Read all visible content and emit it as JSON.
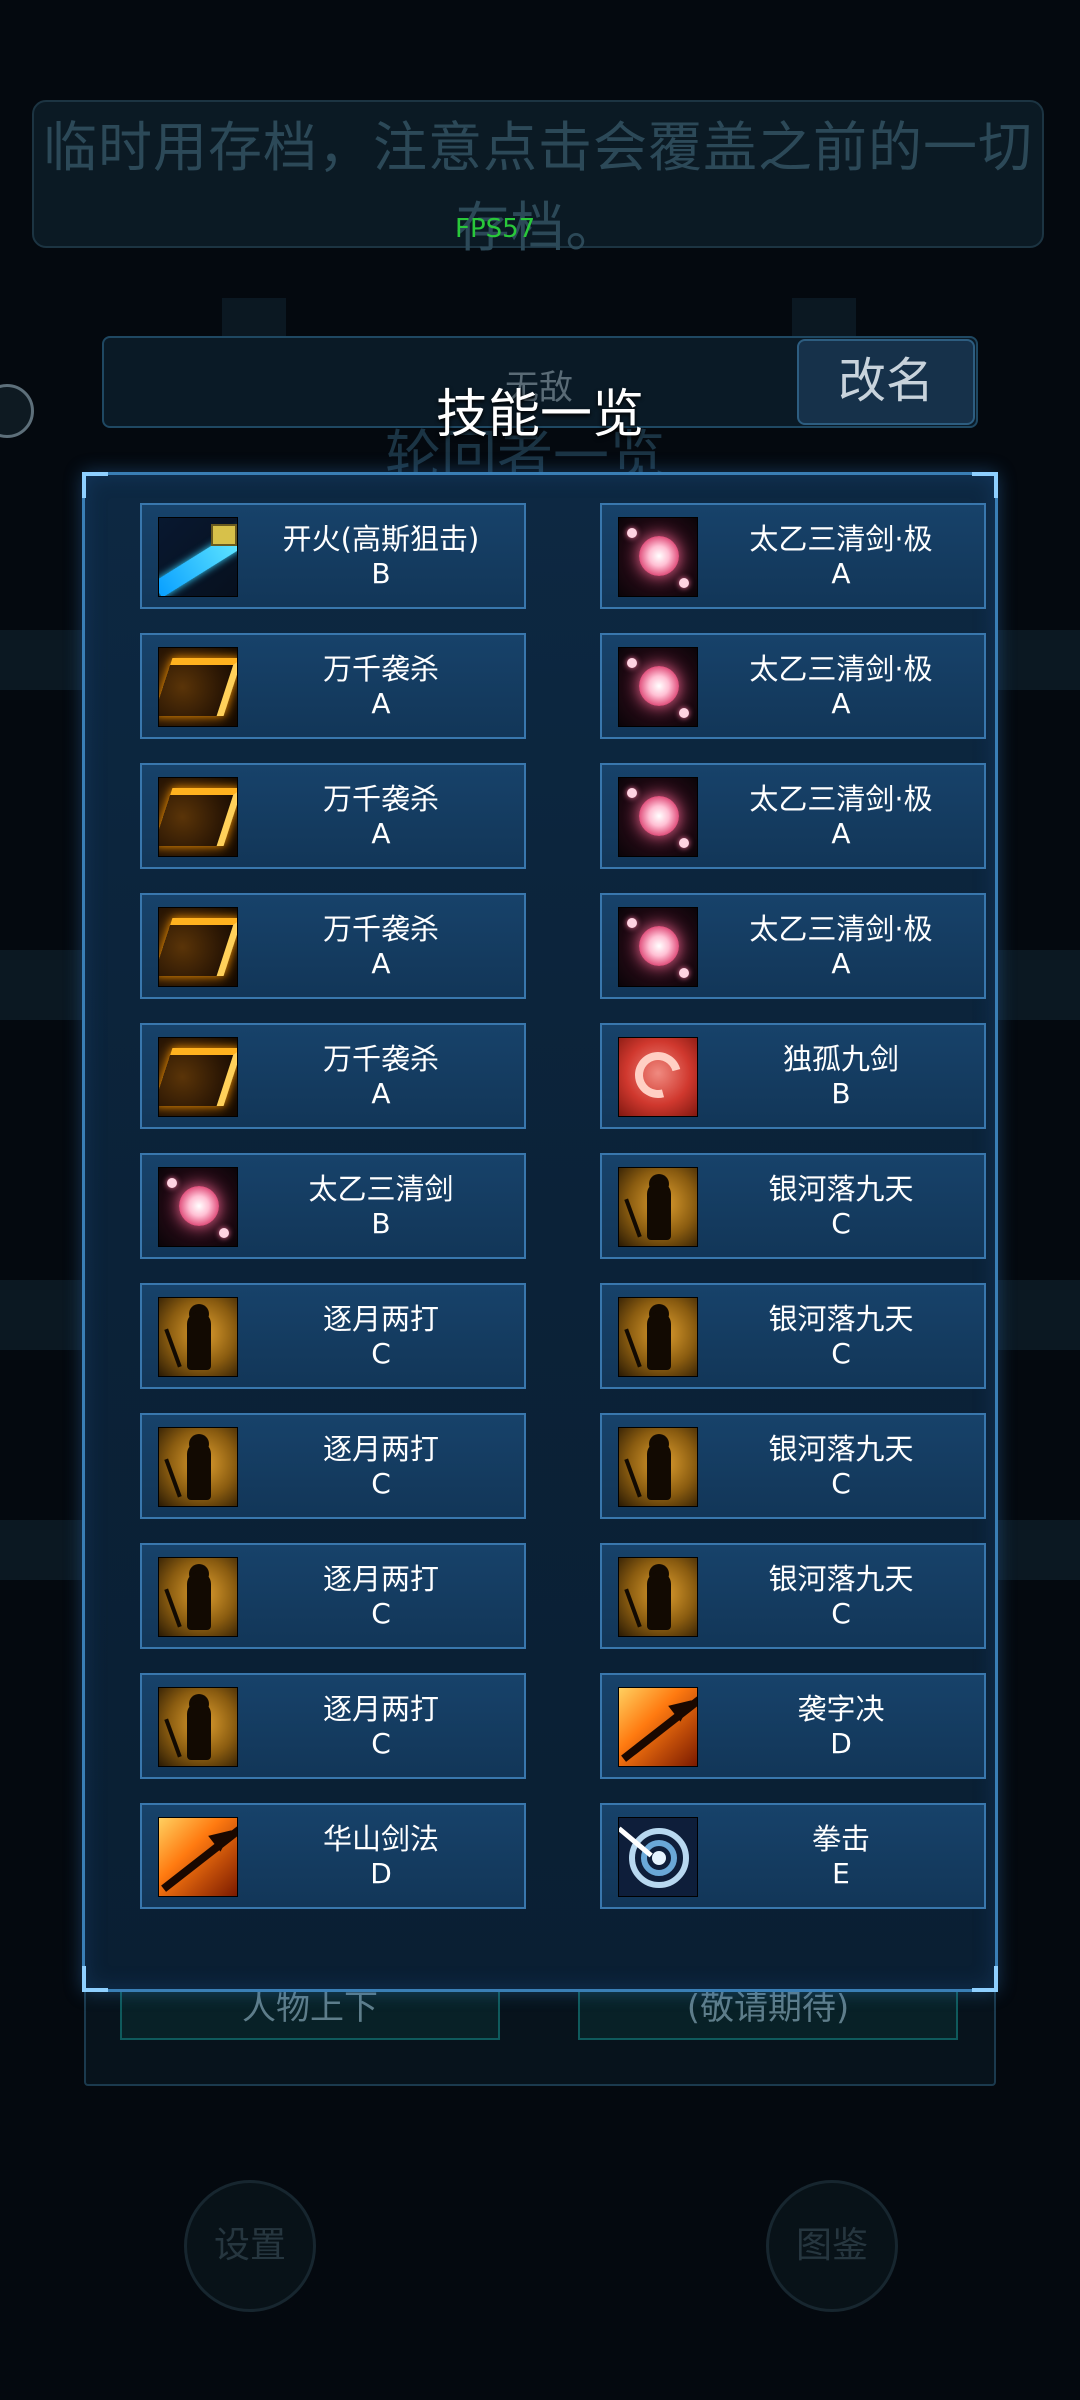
{
  "background": {
    "banner_text_line1": "临时用存档，注意点击会覆盖之前的一切",
    "banner_text_line2": "存档。",
    "fps": "FPS57",
    "name_value": "无敌",
    "rename_label": "改名",
    "list_title": "轮回者一览",
    "bottom_left_button": "人物上下",
    "bottom_right_button": "(敬请期待)",
    "settings_button": "设置",
    "codex_button": "图鉴"
  },
  "modal": {
    "title": "技能一览",
    "skills": [
      {
        "name": "开火(高斯狙击)",
        "grade": "B",
        "icon": "laser-icon"
      },
      {
        "name": "太乙三清剑·极",
        "grade": "A",
        "icon": "orb-icon"
      },
      {
        "name": "万千袭杀",
        "grade": "A",
        "icon": "slash-icon"
      },
      {
        "name": "太乙三清剑·极",
        "grade": "A",
        "icon": "orb-icon"
      },
      {
        "name": "万千袭杀",
        "grade": "A",
        "icon": "slash-icon"
      },
      {
        "name": "太乙三清剑·极",
        "grade": "A",
        "icon": "orb-icon"
      },
      {
        "name": "万千袭杀",
        "grade": "A",
        "icon": "slash-icon"
      },
      {
        "name": "太乙三清剑·极",
        "grade": "A",
        "icon": "orb-icon"
      },
      {
        "name": "万千袭杀",
        "grade": "A",
        "icon": "slash-icon"
      },
      {
        "name": "独孤九剑",
        "grade": "B",
        "icon": "dugu-icon"
      },
      {
        "name": "太乙三清剑",
        "grade": "B",
        "icon": "orb-icon"
      },
      {
        "name": "银河落九天",
        "grade": "C",
        "icon": "silhouette-icon"
      },
      {
        "name": "逐月两打",
        "grade": "C",
        "icon": "silhouette-icon"
      },
      {
        "name": "银河落九天",
        "grade": "C",
        "icon": "silhouette-icon"
      },
      {
        "name": "逐月两打",
        "grade": "C",
        "icon": "silhouette-icon"
      },
      {
        "name": "银河落九天",
        "grade": "C",
        "icon": "silhouette-icon"
      },
      {
        "name": "逐月两打",
        "grade": "C",
        "icon": "silhouette-icon"
      },
      {
        "name": "银河落九天",
        "grade": "C",
        "icon": "silhouette-icon"
      },
      {
        "name": "逐月两打",
        "grade": "C",
        "icon": "silhouette-icon"
      },
      {
        "name": "袭字决",
        "grade": "D",
        "icon": "spear-icon"
      },
      {
        "name": "华山剑法",
        "grade": "D",
        "icon": "spear-icon"
      },
      {
        "name": "拳击",
        "grade": "E",
        "icon": "target-icon"
      }
    ]
  },
  "colors": {
    "panel_border": "#3a7fb6",
    "card_bg": "#17426a",
    "fps_green": "#29c83a"
  }
}
